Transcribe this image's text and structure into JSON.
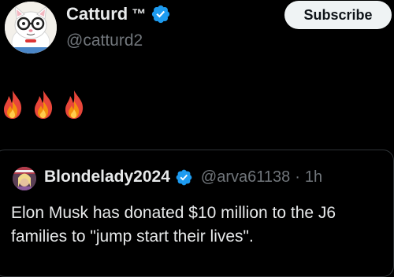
{
  "post": {
    "author_name": "Catturd",
    "author_tm": "™",
    "author_handle": "@catturd2",
    "subscribe_label": "Subscribe",
    "emoji_icons": [
      "fire-icon",
      "fire-icon",
      "fire-icon"
    ]
  },
  "quote": {
    "author_name": "Blondelady2024",
    "author_handle": "@arva61138",
    "separator": "·",
    "time": "1h",
    "text": "Elon Musk has donated $10 million to the J6 families to \"jump start their lives\"."
  },
  "colors": {
    "background": "#000000",
    "text_primary": "#e7e9ea",
    "text_secondary": "#71767b",
    "verified_blue": "#1d9bf0",
    "button_bg": "#eff3f4",
    "fire_orange": "#f4900c",
    "fire_red": "#e8463a"
  }
}
